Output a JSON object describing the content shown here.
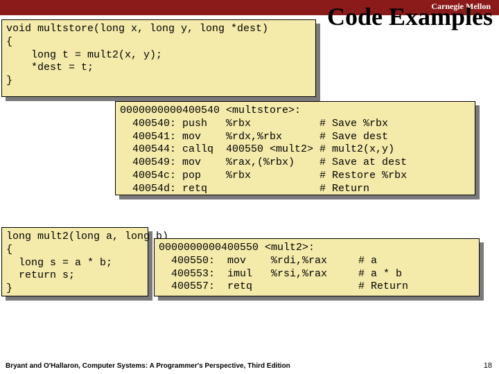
{
  "brand": "Carnegie Mellon",
  "title": "Code Examples",
  "code_multstore_c": "void multstore(long x, long y, long *dest)\n{\n    long t = mult2(x, y);\n    *dest = t;\n}",
  "code_multstore_asm": "0000000000400540 <multstore>:\n  400540: push   %rbx           # Save %rbx\n  400541: mov    %rdx,%rbx      # Save dest\n  400544: callq  400550 <mult2> # mult2(x,y)\n  400549: mov    %rax,(%rbx)    # Save at dest\n  40054c: pop    %rbx           # Restore %rbx\n  40054d: retq                  # Return",
  "code_mult2_c": "long mult2(long a, long b)\n{\n  long s = a * b;\n  return s;\n}",
  "code_mult2_asm": "0000000000400550 <mult2>:\n  400550:  mov    %rdi,%rax     # a\n  400553:  imul   %rsi,%rax     # a * b\n  400557:  retq                 # Return",
  "footer": "Bryant and O'Hallaron, Computer Systems: A Programmer's Perspective, Third Edition",
  "page": "18"
}
